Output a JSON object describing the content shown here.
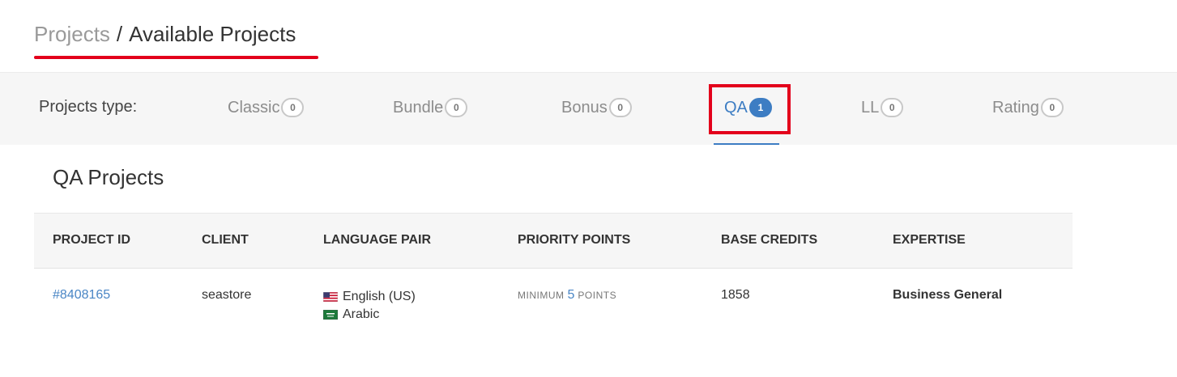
{
  "breadcrumb": {
    "root": "Projects",
    "separator": "/",
    "current": "Available Projects"
  },
  "tabs": {
    "label": "Projects type:",
    "items": [
      {
        "label": "Classic",
        "count": "0"
      },
      {
        "label": "Bundle",
        "count": "0"
      },
      {
        "label": "Bonus",
        "count": "0"
      },
      {
        "label": "QA",
        "count": "1",
        "active": true
      },
      {
        "label": "LL",
        "count": "0"
      },
      {
        "label": "Rating",
        "count": "0"
      }
    ]
  },
  "section": {
    "title": "QA Projects"
  },
  "table": {
    "headers": [
      "PROJECT ID",
      "CLIENT",
      "LANGUAGE PAIR",
      "PRIORITY POINTS",
      "BASE CREDITS",
      "EXPERTISE"
    ],
    "rows": [
      {
        "project_id": "#8408165",
        "client": "seastore",
        "source_language": "English (US)",
        "target_language": "Arabic",
        "priority_prefix": "MINIMUM",
        "priority_value": "5",
        "priority_suffix": "POINTS",
        "base_credits": "1858",
        "expertise": "Business General"
      }
    ]
  },
  "colors": {
    "accent": "#3d7dc3",
    "highlight": "#e3001b",
    "link": "#4a86c5"
  }
}
